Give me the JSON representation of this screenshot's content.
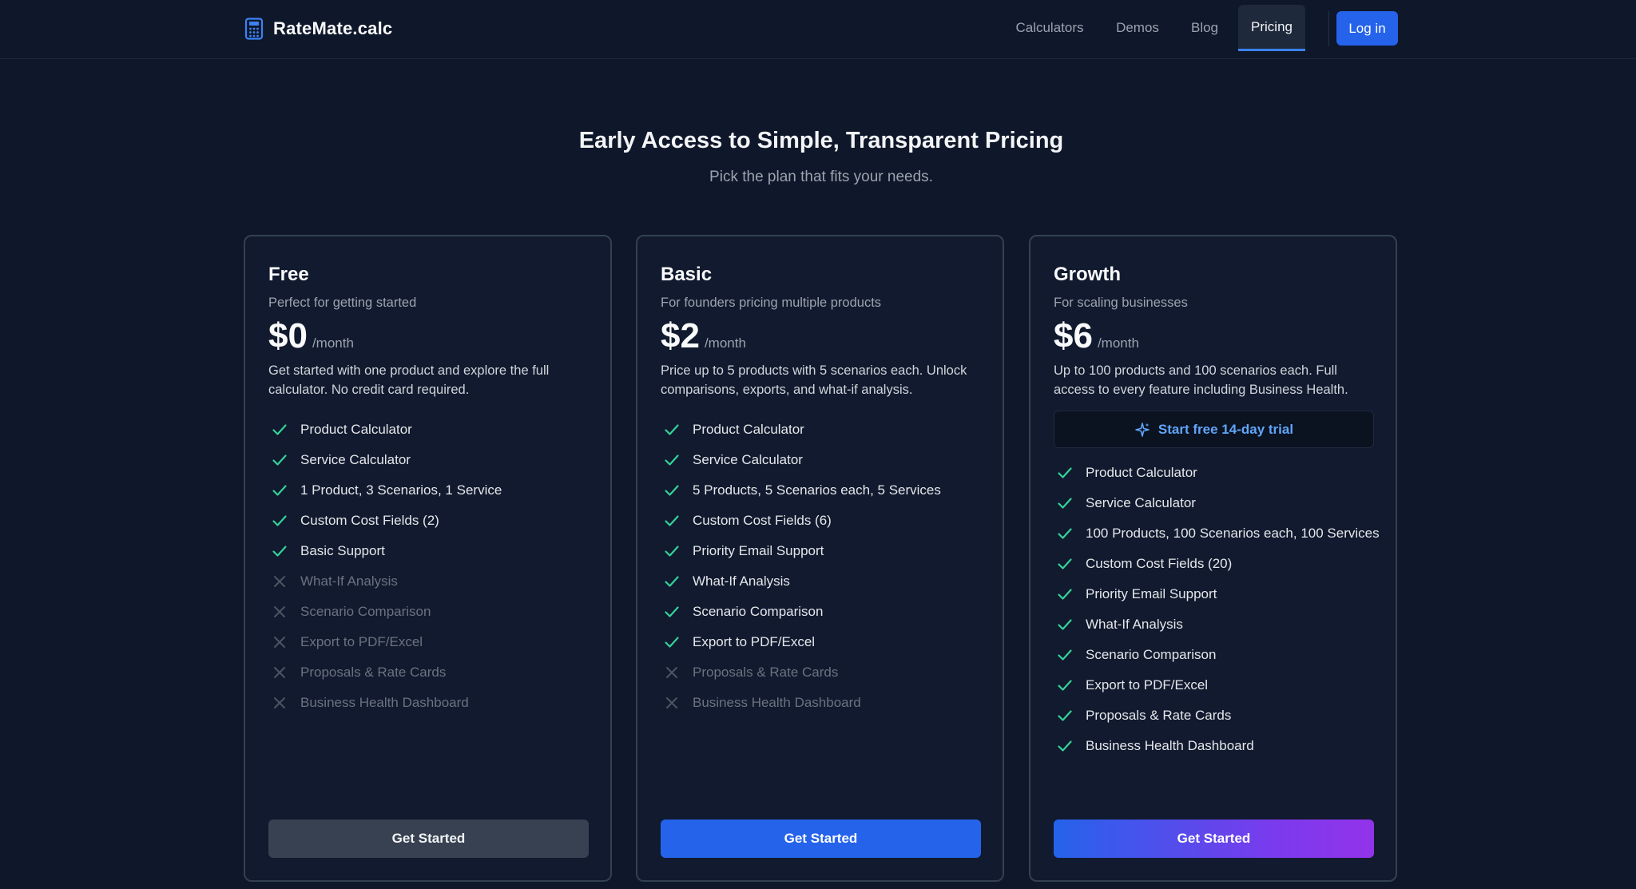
{
  "header": {
    "brand": "RateMate.calc",
    "nav": [
      "Calculators",
      "Demos",
      "Blog",
      "Pricing"
    ],
    "active_nav": "Pricing",
    "login_label": "Log in"
  },
  "hero": {
    "title": "Early Access to Simple, Transparent Pricing",
    "subtitle": "Pick the plan that fits your needs."
  },
  "plans": [
    {
      "name": "Free",
      "tagline": "Perfect for getting started",
      "price": "$0",
      "period": "/month",
      "description": "Get started with one product and explore the full calculator. No credit card required.",
      "features": [
        {
          "label": "Product Calculator",
          "included": true
        },
        {
          "label": "Service Calculator",
          "included": true
        },
        {
          "label": "1 Product, 3 Scenarios, 1 Service",
          "included": true
        },
        {
          "label": "Custom Cost Fields (2)",
          "included": true
        },
        {
          "label": "Basic Support",
          "included": true
        },
        {
          "label": "What-If Analysis",
          "included": false
        },
        {
          "label": "Scenario Comparison",
          "included": false
        },
        {
          "label": "Export to PDF/Excel",
          "included": false
        },
        {
          "label": "Proposals & Rate Cards",
          "included": false
        },
        {
          "label": "Business Health Dashboard",
          "included": false
        }
      ],
      "cta": "Get Started"
    },
    {
      "name": "Basic",
      "tagline": "For founders pricing multiple products",
      "price": "$2",
      "period": "/month",
      "description": "Price up to 5 products with 5 scenarios each. Unlock comparisons, exports, and what-if analysis.",
      "features": [
        {
          "label": "Product Calculator",
          "included": true
        },
        {
          "label": "Service Calculator",
          "included": true
        },
        {
          "label": "5 Products, 5 Scenarios each, 5 Services",
          "included": true
        },
        {
          "label": "Custom Cost Fields (6)",
          "included": true
        },
        {
          "label": "Priority Email Support",
          "included": true
        },
        {
          "label": "What-If Analysis",
          "included": true
        },
        {
          "label": "Scenario Comparison",
          "included": true
        },
        {
          "label": "Export to PDF/Excel",
          "included": true
        },
        {
          "label": "Proposals & Rate Cards",
          "included": false
        },
        {
          "label": "Business Health Dashboard",
          "included": false
        }
      ],
      "cta": "Get Started"
    },
    {
      "name": "Growth",
      "tagline": "For scaling businesses",
      "price": "$6",
      "period": "/month",
      "description": "Up to 100 products and 100 scenarios each. Full access to every feature including Business Health.",
      "trial_label": "Start free 14-day trial",
      "features": [
        {
          "label": "Product Calculator",
          "included": true
        },
        {
          "label": "Service Calculator",
          "included": true
        },
        {
          "label": "100 Products, 100 Scenarios each, 100 Services",
          "included": true
        },
        {
          "label": "Custom Cost Fields (20)",
          "included": true
        },
        {
          "label": "Priority Email Support",
          "included": true
        },
        {
          "label": "What-If Analysis",
          "included": true
        },
        {
          "label": "Scenario Comparison",
          "included": true
        },
        {
          "label": "Export to PDF/Excel",
          "included": true
        },
        {
          "label": "Proposals & Rate Cards",
          "included": true
        },
        {
          "label": "Business Health Dashboard",
          "included": true
        }
      ],
      "cta": "Get Started"
    }
  ],
  "colors": {
    "background": "#0f172a",
    "accent": "#2563eb",
    "check": "#34d399",
    "cross": "#4b5563",
    "gradient_end": "#9333ea"
  },
  "icons": {
    "brand": "calculator-icon",
    "included": "check-icon",
    "excluded": "x-icon",
    "trial": "sparkles-icon"
  }
}
